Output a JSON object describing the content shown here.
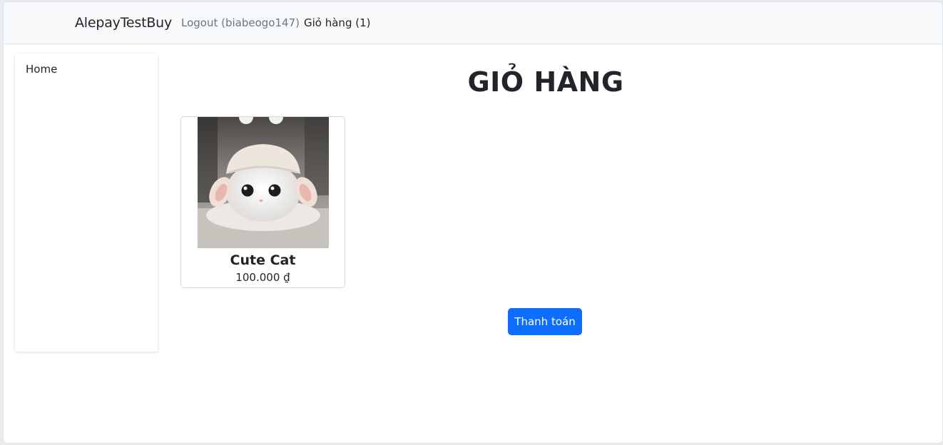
{
  "navbar": {
    "brand": "AlepayTestBuy",
    "logout_label": "Logout (biabeogo147)",
    "cart_label": "Giỏ hàng (1)"
  },
  "sidebar": {
    "items": [
      {
        "label": "Home"
      }
    ]
  },
  "main": {
    "title": "GIỎ HÀNG",
    "cart_items": [
      {
        "name": "Cute Cat",
        "price": "100.000 ₫",
        "image": "white kitten wearing a knitted hat"
      }
    ],
    "checkout_label": "Thanh toán"
  },
  "colors": {
    "primary": "#0d6efd",
    "navbar_bg": "#f8f9fa",
    "text": "#212529",
    "muted": "#6c757d"
  }
}
